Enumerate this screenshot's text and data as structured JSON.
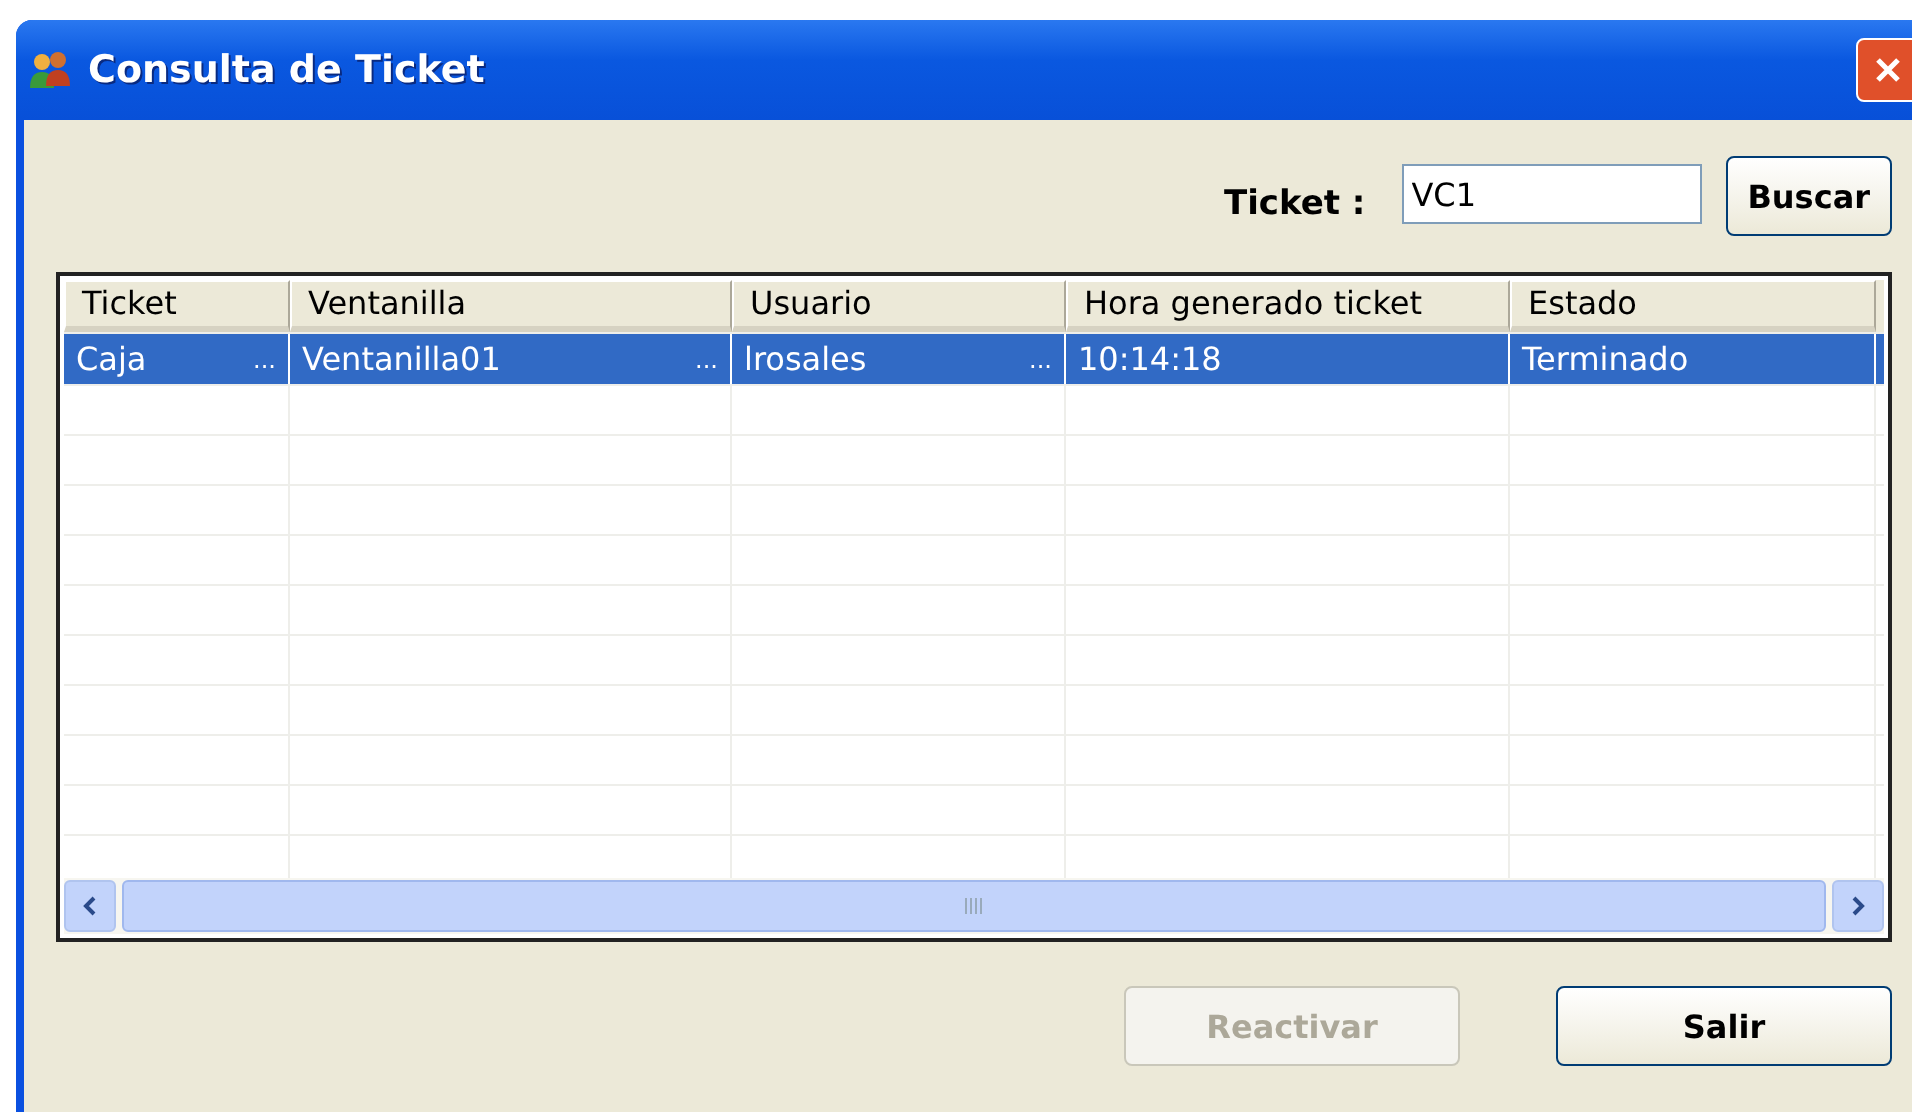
{
  "window": {
    "title": "Consulta de Ticket"
  },
  "search": {
    "label": "Ticket :",
    "value": "VC1",
    "button": "Buscar"
  },
  "table": {
    "columns": [
      "Ticket",
      "Ventanilla",
      "Usuario",
      "Hora generado ticket",
      "Estado"
    ],
    "rows": [
      {
        "selected": true,
        "cells": [
          {
            "text": "Caja",
            "more": "..."
          },
          {
            "text": "Ventanilla01",
            "more": "..."
          },
          {
            "text": "lrosales",
            "more": "..."
          },
          {
            "text": "10:14:18"
          },
          {
            "text": "Terminado"
          }
        ]
      }
    ]
  },
  "buttons": [
    {
      "label": "Reactivar",
      "disabled": true
    },
    {
      "label": "Salir",
      "disabled": false
    }
  ]
}
